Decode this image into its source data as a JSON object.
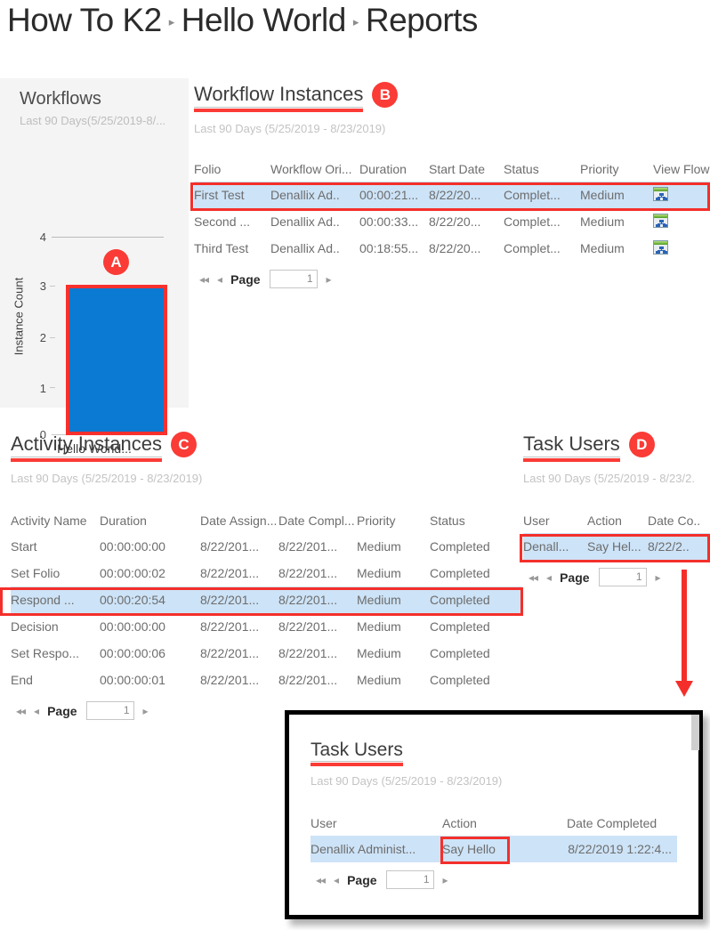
{
  "breadcrumb": {
    "items": [
      "How To K2",
      "Hello World",
      "Reports"
    ],
    "separator": "▸"
  },
  "chart_panel": {
    "title": "Workflows",
    "subtitle": "Last 90 Days(5/25/2019-8/...",
    "badge": "A"
  },
  "chart_data": {
    "type": "bar",
    "title": "Workflows",
    "subtitle": "Last 90 Days(5/25/2019-8/...",
    "categories": [
      "Hello World..."
    ],
    "values": [
      3
    ],
    "xlabel": "",
    "ylabel": "Instance Count",
    "ylim": [
      0,
      4
    ],
    "yticks": [
      0,
      1,
      2,
      3,
      4
    ],
    "grid": "top-only",
    "legend": "none",
    "bar_color": "#0b7ad2",
    "highlight_color": "#f8312f"
  },
  "workflow_instances": {
    "title": "Workflow Instances",
    "badge": "B",
    "subtitle": "Last 90 Days (5/25/2019 - 8/23/2019)",
    "columns": [
      "Folio",
      "Workflow Ori...",
      "Duration",
      "Start Date",
      "Status",
      "Priority",
      "View Flow"
    ],
    "rows": [
      {
        "folio": "First Test",
        "originator": "Denallix Ad..",
        "duration": "00:00:21...",
        "start_date": "8/22/20...",
        "status": "Complet...",
        "priority": "Medium",
        "view_flow_icon": "view-flow-icon",
        "selected": true
      },
      {
        "folio": "Second ...",
        "originator": "Denallix Ad..",
        "duration": "00:00:33...",
        "start_date": "8/22/20...",
        "status": "Complet...",
        "priority": "Medium",
        "view_flow_icon": "view-flow-icon",
        "selected": false
      },
      {
        "folio": "Third Test",
        "originator": "Denallix Ad..",
        "duration": "00:18:55...",
        "start_date": "8/22/20...",
        "status": "Complet...",
        "priority": "Medium",
        "view_flow_icon": "view-flow-icon",
        "selected": false
      }
    ],
    "pager": {
      "first_icon": "◂◂",
      "prev_icon": "◂",
      "label": "Page",
      "value": "1",
      "next_icon": "▸"
    }
  },
  "activity_instances": {
    "title": "Activity Instances",
    "badge": "C",
    "subtitle": "Last 90 Days (5/25/2019 - 8/23/2019)",
    "columns": [
      "Activity Name",
      "Duration",
      "Date Assign...",
      "Date Compl...",
      "Priority",
      "Status"
    ],
    "rows": [
      {
        "name": "Start",
        "duration": "00:00:00:00",
        "assigned": "8/22/201...",
        "completed": "8/22/201...",
        "priority": "Medium",
        "status": "Completed",
        "selected": false
      },
      {
        "name": "Set Folio",
        "duration": "00:00:00:02",
        "assigned": "8/22/201...",
        "completed": "8/22/201...",
        "priority": "Medium",
        "status": "Completed",
        "selected": false
      },
      {
        "name": "Respond ...",
        "duration": "00:00:20:54",
        "assigned": "8/22/201...",
        "completed": "8/22/201...",
        "priority": "Medium",
        "status": "Completed",
        "selected": true
      },
      {
        "name": "Decision",
        "duration": "00:00:00:00",
        "assigned": "8/22/201...",
        "completed": "8/22/201...",
        "priority": "Medium",
        "status": "Completed",
        "selected": false
      },
      {
        "name": "Set Respo...",
        "duration": "00:00:00:06",
        "assigned": "8/22/201...",
        "completed": "8/22/201...",
        "priority": "Medium",
        "status": "Completed",
        "selected": false
      },
      {
        "name": "End",
        "duration": "00:00:00:01",
        "assigned": "8/22/201...",
        "completed": "8/22/201...",
        "priority": "Medium",
        "status": "Completed",
        "selected": false
      }
    ],
    "pager": {
      "first_icon": "◂◂",
      "prev_icon": "◂",
      "label": "Page",
      "value": "1",
      "next_icon": "▸"
    }
  },
  "task_users": {
    "title": "Task Users",
    "badge": "D",
    "subtitle": "Last 90 Days (5/25/2019 - 8/23/2.",
    "columns": [
      "User",
      "Action",
      "Date Co.."
    ],
    "rows": [
      {
        "user": "Denall...",
        "action": "Say Hel...",
        "date_completed": "8/22/2..",
        "selected": true
      }
    ],
    "pager": {
      "first_icon": "◂◂",
      "prev_icon": "◂",
      "label": "Page",
      "value": "1",
      "next_icon": "▸"
    }
  },
  "inset": {
    "title": "Task Users",
    "subtitle": "Last 90 Days (5/25/2019 - 8/23/2019)",
    "columns": [
      "User",
      "Action",
      "Date Completed"
    ],
    "rows": [
      {
        "user": "Denallix Administ...",
        "action": "Say Hello",
        "date_completed": "8/22/2019 1:22:4...",
        "selected": true
      }
    ],
    "pager": {
      "first_icon": "◂◂",
      "prev_icon": "◂",
      "label": "Page",
      "value": "1",
      "next_icon": "▸"
    }
  },
  "annotation": {
    "accent_color": "#f42f2b",
    "arrow": "down-arrow"
  }
}
